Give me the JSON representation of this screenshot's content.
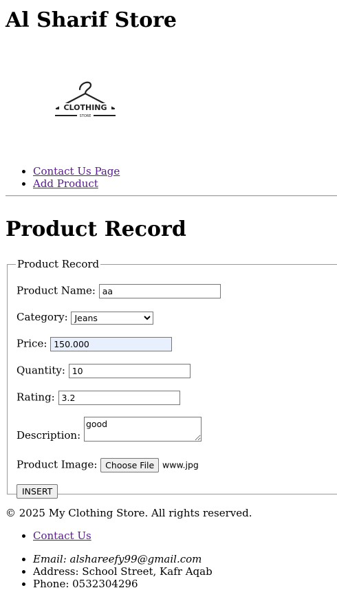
{
  "header": {
    "store_name": "Al Sharif Store",
    "logo_text": "CLOTHING",
    "logo_subtext": "STORE"
  },
  "nav": {
    "items": [
      {
        "label": "Contact Us Page"
      },
      {
        "label": "Add Product"
      }
    ]
  },
  "page_title": "Product Record",
  "form": {
    "legend": "Product Record",
    "product_name_label": "Product Name:",
    "product_name_value": "aa",
    "category_label": "Category:",
    "category_value": "Jeans",
    "price_label": "Price:",
    "price_value": "150.000",
    "quantity_label": "Quantity:",
    "quantity_value": "10",
    "rating_label": "Rating:",
    "rating_value": "3.2",
    "description_label": "Description:",
    "description_value": "good",
    "image_label": "Product Image:",
    "choose_file_label": "Choose File",
    "file_name": "www.jpg",
    "insert_label": "INSERT"
  },
  "footer": {
    "copyright": "© 2025 My Clothing Store. All rights reserved.",
    "contact_link": "Contact Us",
    "email": "Email: alshareefy99@gmail.com",
    "address": "Address: School Street, Kafr Aqab",
    "phone": "Phone: 0532304296"
  },
  "colors": {
    "link_visited": "#551a8b",
    "price_autofill_bg": "#e8f0fe"
  }
}
